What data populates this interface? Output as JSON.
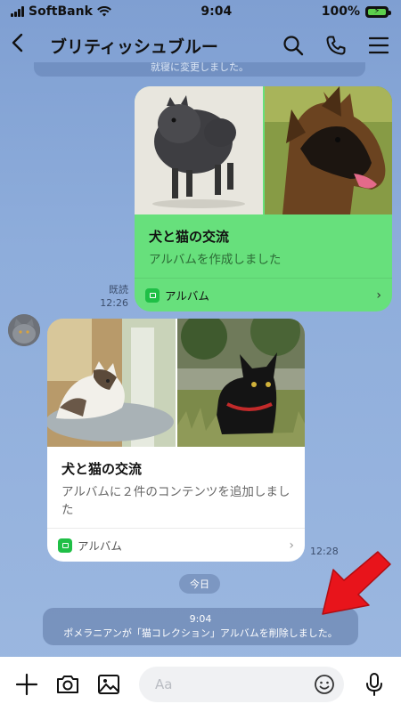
{
  "status": {
    "carrier": "SoftBank",
    "time": "9:04",
    "battery": "100%"
  },
  "header": {
    "title": "ブリティッシュブルー"
  },
  "partial_message": {
    "text": "就寝に変更しました。"
  },
  "sent_card": {
    "title": "犬と猫の交流",
    "subtitle": "アルバムを作成しました",
    "footer_label": "アルバム",
    "read_label": "既読",
    "time": "12:26"
  },
  "received_card": {
    "title": "犬と猫の交流",
    "subtitle": "アルバムに２件のコンテンツを追加しました",
    "footer_label": "アルバム",
    "time": "12:28"
  },
  "date_divider": "今日",
  "system_notice": {
    "time": "9:04",
    "text": "ポメラニアンが「猫コレクション」アルバムを削除しました。"
  },
  "input": {
    "placeholder": "Aa"
  },
  "colors": {
    "accent_green": "#67e07c",
    "annotation_arrow": "#e8141b",
    "chat_bg": "#8aa9d8"
  }
}
